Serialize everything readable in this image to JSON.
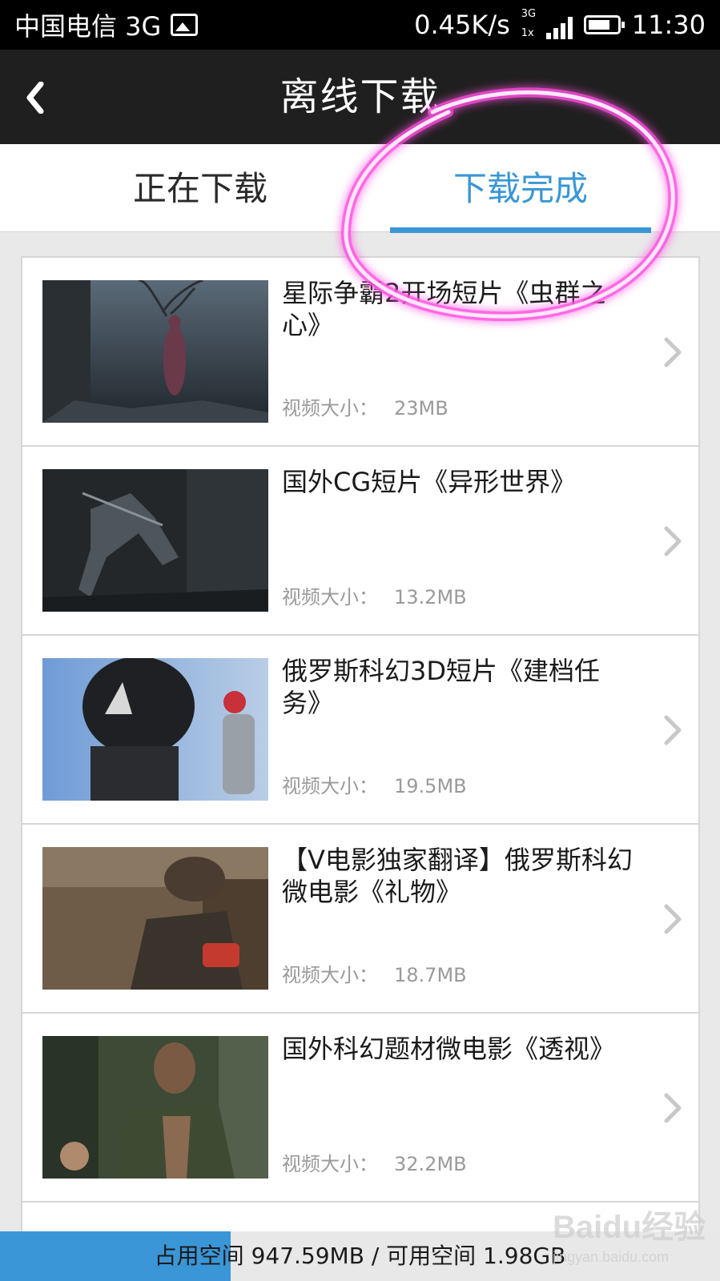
{
  "status_bar": {
    "carrier": "中国电信 3G",
    "speed": "0.45K/s",
    "net_top": "3G",
    "net_bottom": "1x",
    "time": "11:30"
  },
  "header": {
    "back_icon": "chevron-left-icon",
    "title": "离线下载"
  },
  "tabs": [
    {
      "label": "正在下载",
      "active": false
    },
    {
      "label": "下载完成",
      "active": true
    }
  ],
  "size_label": "视频大小：",
  "items": [
    {
      "title": "星际争霸2开场短片《虫群之心》",
      "size": "23MB"
    },
    {
      "title": "国外CG短片《异形世界》",
      "size": "13.2MB"
    },
    {
      "title": "俄罗斯科幻3D短片《建档任务》",
      "size": "19.5MB"
    },
    {
      "title": "【V电影独家翻译】俄罗斯科幻微电影《礼物》",
      "size": "18.7MB"
    },
    {
      "title": "国外科幻题材微电影《透视》",
      "size": "32.2MB"
    }
  ],
  "storage": {
    "text": "占用空间 947.59MB / 可用空间 1.98GB",
    "used_fraction": 0.32
  },
  "watermark": {
    "brand": "Baidu经验",
    "site": "jingyan.baidu.com"
  },
  "colors": {
    "accent": "#3a96d6",
    "annotation": "#ff4fe0"
  }
}
